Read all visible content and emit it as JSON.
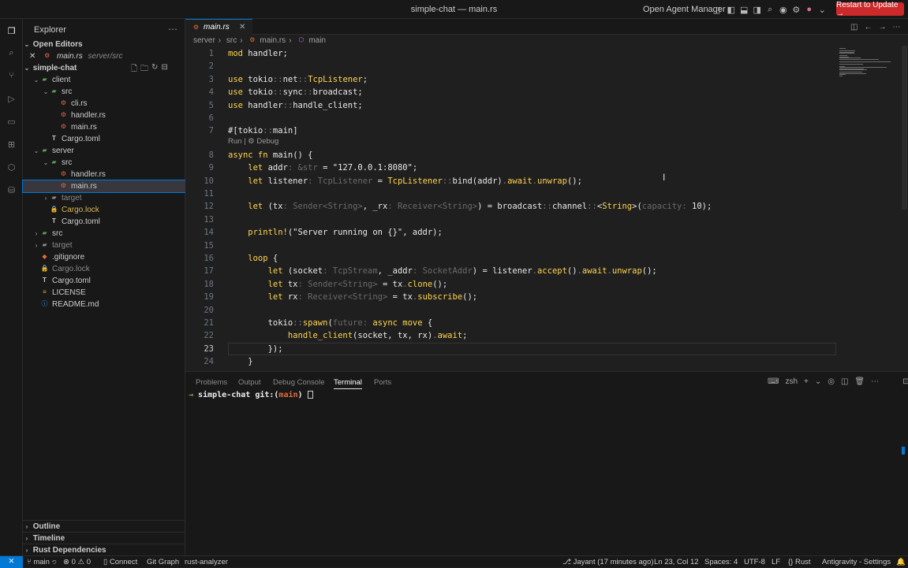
{
  "window": {
    "title": "simple-chat — main.rs",
    "agent_label": "Open Agent Manager",
    "update_button": "Restart to Update →"
  },
  "activitybar": {
    "items": [
      "files-icon",
      "search-icon",
      "source-control-icon",
      "run-debug-icon",
      "remote-explorer-icon",
      "extensions-icon",
      "agent-icon",
      "database-icon"
    ]
  },
  "sidebar": {
    "header": "Explorer",
    "open_editors": {
      "label": "Open Editors",
      "items": [
        {
          "name": "main.rs",
          "path": "server/src"
        }
      ]
    },
    "workspace": "simple-chat",
    "tree": [
      {
        "label": "client",
        "depth": 1,
        "kind": "folder-open"
      },
      {
        "label": "src",
        "depth": 2,
        "kind": "folder-open"
      },
      {
        "label": "cli.rs",
        "depth": 3,
        "kind": "rs"
      },
      {
        "label": "handler.rs",
        "depth": 3,
        "kind": "rs"
      },
      {
        "label": "main.rs",
        "depth": 3,
        "kind": "rs"
      },
      {
        "label": "Cargo.toml",
        "depth": 2,
        "kind": "toml"
      },
      {
        "label": "server",
        "depth": 1,
        "kind": "folder-open"
      },
      {
        "label": "src",
        "depth": 2,
        "kind": "folder-open"
      },
      {
        "label": "handler.rs",
        "depth": 3,
        "kind": "rs"
      },
      {
        "label": "main.rs",
        "depth": 3,
        "kind": "rs",
        "selected": true
      },
      {
        "label": "target",
        "depth": 2,
        "kind": "folder-closed-muted"
      },
      {
        "label": "Cargo.lock",
        "depth": 2,
        "kind": "lock"
      },
      {
        "label": "Cargo.toml",
        "depth": 2,
        "kind": "toml"
      },
      {
        "label": "src",
        "depth": 1,
        "kind": "folder-closed"
      },
      {
        "label": "target",
        "depth": 1,
        "kind": "folder-closed-muted"
      },
      {
        "label": ".gitignore",
        "depth": 1,
        "kind": "git"
      },
      {
        "label": "Cargo.lock",
        "depth": 1,
        "kind": "lock-muted"
      },
      {
        "label": "Cargo.toml",
        "depth": 1,
        "kind": "toml"
      },
      {
        "label": "LICENSE",
        "depth": 1,
        "kind": "license"
      },
      {
        "label": "README.md",
        "depth": 1,
        "kind": "info"
      }
    ],
    "bottom_sections": [
      "Outline",
      "Timeline",
      "Rust Dependencies"
    ]
  },
  "editor": {
    "tab": "main.rs",
    "breadcrumb": [
      "server",
      "src",
      "main.rs",
      "main"
    ],
    "codelens": "Run | ⚙ Debug",
    "current_line": 23,
    "lines": [
      {
        "n": "1",
        "segs": [
          [
            "kw",
            "mod "
          ],
          [
            "wht",
            "handler;"
          ]
        ]
      },
      {
        "n": "2",
        "segs": []
      },
      {
        "n": "3",
        "segs": [
          [
            "kw",
            "use "
          ],
          [
            "wht",
            "tokio"
          ],
          [
            "op",
            "::"
          ],
          [
            "wht",
            "net"
          ],
          [
            "op",
            "::"
          ],
          [
            "fnc",
            "TcpListener"
          ],
          [
            "wht",
            ";"
          ]
        ]
      },
      {
        "n": "4",
        "segs": [
          [
            "kw",
            "use "
          ],
          [
            "wht",
            "tokio"
          ],
          [
            "op",
            "::"
          ],
          [
            "wht",
            "sync"
          ],
          [
            "op",
            "::"
          ],
          [
            "wht",
            "broadcast;"
          ]
        ]
      },
      {
        "n": "5",
        "segs": [
          [
            "kw",
            "use "
          ],
          [
            "wht",
            "handler"
          ],
          [
            "op",
            "::"
          ],
          [
            "wht",
            "handle_client;"
          ]
        ]
      },
      {
        "n": "6",
        "segs": []
      },
      {
        "n": "7",
        "segs": [
          [
            "wht",
            "#[tokio"
          ],
          [
            "op",
            "::"
          ],
          [
            "wht",
            "main]"
          ]
        ]
      },
      {
        "n": "8",
        "segs": [
          [
            "kw",
            "async fn "
          ],
          [
            "wht",
            "main() {"
          ]
        ]
      },
      {
        "n": "9",
        "segs": [
          [
            "kw",
            "    let "
          ],
          [
            "wht",
            "addr"
          ],
          [
            "typ",
            ": &str"
          ],
          [
            "wht",
            " = \"127.0.0.1:8080\";"
          ]
        ]
      },
      {
        "n": "10",
        "segs": [
          [
            "kw",
            "    let "
          ],
          [
            "wht",
            "listener"
          ],
          [
            "typ",
            ": TcpListener"
          ],
          [
            "wht",
            " = "
          ],
          [
            "fnc",
            "TcpListener"
          ],
          [
            "op",
            "::"
          ],
          [
            "wht",
            "bind(addr)"
          ],
          [
            "op",
            "."
          ],
          [
            "fnc",
            "await"
          ],
          [
            "op",
            "."
          ],
          [
            "fnc",
            "unwrap"
          ],
          [
            "wht",
            "();"
          ]
        ]
      },
      {
        "n": "11",
        "segs": []
      },
      {
        "n": "12",
        "segs": [
          [
            "kw",
            "    let "
          ],
          [
            "wht",
            "(tx"
          ],
          [
            "typ",
            ": Sender<String>"
          ],
          [
            "wht",
            ", _rx"
          ],
          [
            "typ",
            ": Receiver<String>"
          ],
          [
            "wht",
            ") = broadcast"
          ],
          [
            "op",
            "::"
          ],
          [
            "wht",
            "channel"
          ],
          [
            "op",
            "::"
          ],
          [
            "wht",
            "<"
          ],
          [
            "fnc",
            "String"
          ],
          [
            "wht",
            ">("
          ],
          [
            "typ",
            "capacity: "
          ],
          [
            "wht",
            "10);"
          ]
        ]
      },
      {
        "n": "13",
        "segs": []
      },
      {
        "n": "14",
        "segs": [
          [
            "fnc",
            "    println!"
          ],
          [
            "wht",
            "(\"Server running on {}\", addr);"
          ]
        ]
      },
      {
        "n": "15",
        "segs": []
      },
      {
        "n": "16",
        "segs": [
          [
            "kw",
            "    loop "
          ],
          [
            "wht",
            "{"
          ]
        ]
      },
      {
        "n": "17",
        "segs": [
          [
            "kw",
            "        let "
          ],
          [
            "wht",
            "(socket"
          ],
          [
            "typ",
            ": TcpStream"
          ],
          [
            "wht",
            ", _addr"
          ],
          [
            "typ",
            ": SocketAddr"
          ],
          [
            "wht",
            ") = listener"
          ],
          [
            "op",
            "."
          ],
          [
            "fnc",
            "accept"
          ],
          [
            "wht",
            "()"
          ],
          [
            "op",
            "."
          ],
          [
            "fnc",
            "await"
          ],
          [
            "op",
            "."
          ],
          [
            "fnc",
            "unwrap"
          ],
          [
            "wht",
            "();"
          ]
        ]
      },
      {
        "n": "18",
        "segs": [
          [
            "kw",
            "        let "
          ],
          [
            "wht",
            "tx"
          ],
          [
            "typ",
            ": Sender<String>"
          ],
          [
            "wht",
            " = tx"
          ],
          [
            "op",
            "."
          ],
          [
            "fnc",
            "clone"
          ],
          [
            "wht",
            "();"
          ]
        ]
      },
      {
        "n": "19",
        "segs": [
          [
            "kw",
            "        let "
          ],
          [
            "wht",
            "rx"
          ],
          [
            "typ",
            ": Receiver<String>"
          ],
          [
            "wht",
            " = tx"
          ],
          [
            "op",
            "."
          ],
          [
            "fnc",
            "subscribe"
          ],
          [
            "wht",
            "();"
          ]
        ]
      },
      {
        "n": "20",
        "segs": []
      },
      {
        "n": "21",
        "segs": [
          [
            "wht",
            "        tokio"
          ],
          [
            "op",
            "::"
          ],
          [
            "fnc",
            "spawn"
          ],
          [
            "wht",
            "("
          ],
          [
            "typ",
            "future: "
          ],
          [
            "kw",
            "async move "
          ],
          [
            "wht",
            "{"
          ]
        ]
      },
      {
        "n": "22",
        "segs": [
          [
            "fnc",
            "            handle_client"
          ],
          [
            "wht",
            "(socket, tx, rx)"
          ],
          [
            "op",
            "."
          ],
          [
            "fnc",
            "await"
          ],
          [
            "wht",
            ";"
          ]
        ]
      },
      {
        "n": "23",
        "segs": [
          [
            "wht",
            "        });"
          ]
        ]
      },
      {
        "n": "24",
        "segs": [
          [
            "wht",
            "    }"
          ]
        ]
      }
    ]
  },
  "panel": {
    "tabs": [
      "Problems",
      "Output",
      "Debug Console",
      "Terminal",
      "Ports"
    ],
    "active_tab": "Terminal",
    "shell": "zsh",
    "prompt_dir": "simple-chat",
    "prompt_git": "git:(",
    "prompt_branch": "main",
    "prompt_end": ")"
  },
  "statusbar": {
    "branch": "main",
    "errors": "0",
    "warnings": "0",
    "connect": "Connect",
    "git_graph": "Git Graph",
    "analyzer": "rust-analyzer",
    "blame": "Jayant (17 minutes ago)",
    "position": "Ln 23, Col 12",
    "spaces": "Spaces: 4",
    "encoding": "UTF-8",
    "eol": "LF",
    "language": "Rust",
    "settings": "Antigravity - Settings"
  },
  "colors": {
    "accent": "#0078d4",
    "update": "#cc2a2a",
    "keyword": "#ffd54f"
  }
}
